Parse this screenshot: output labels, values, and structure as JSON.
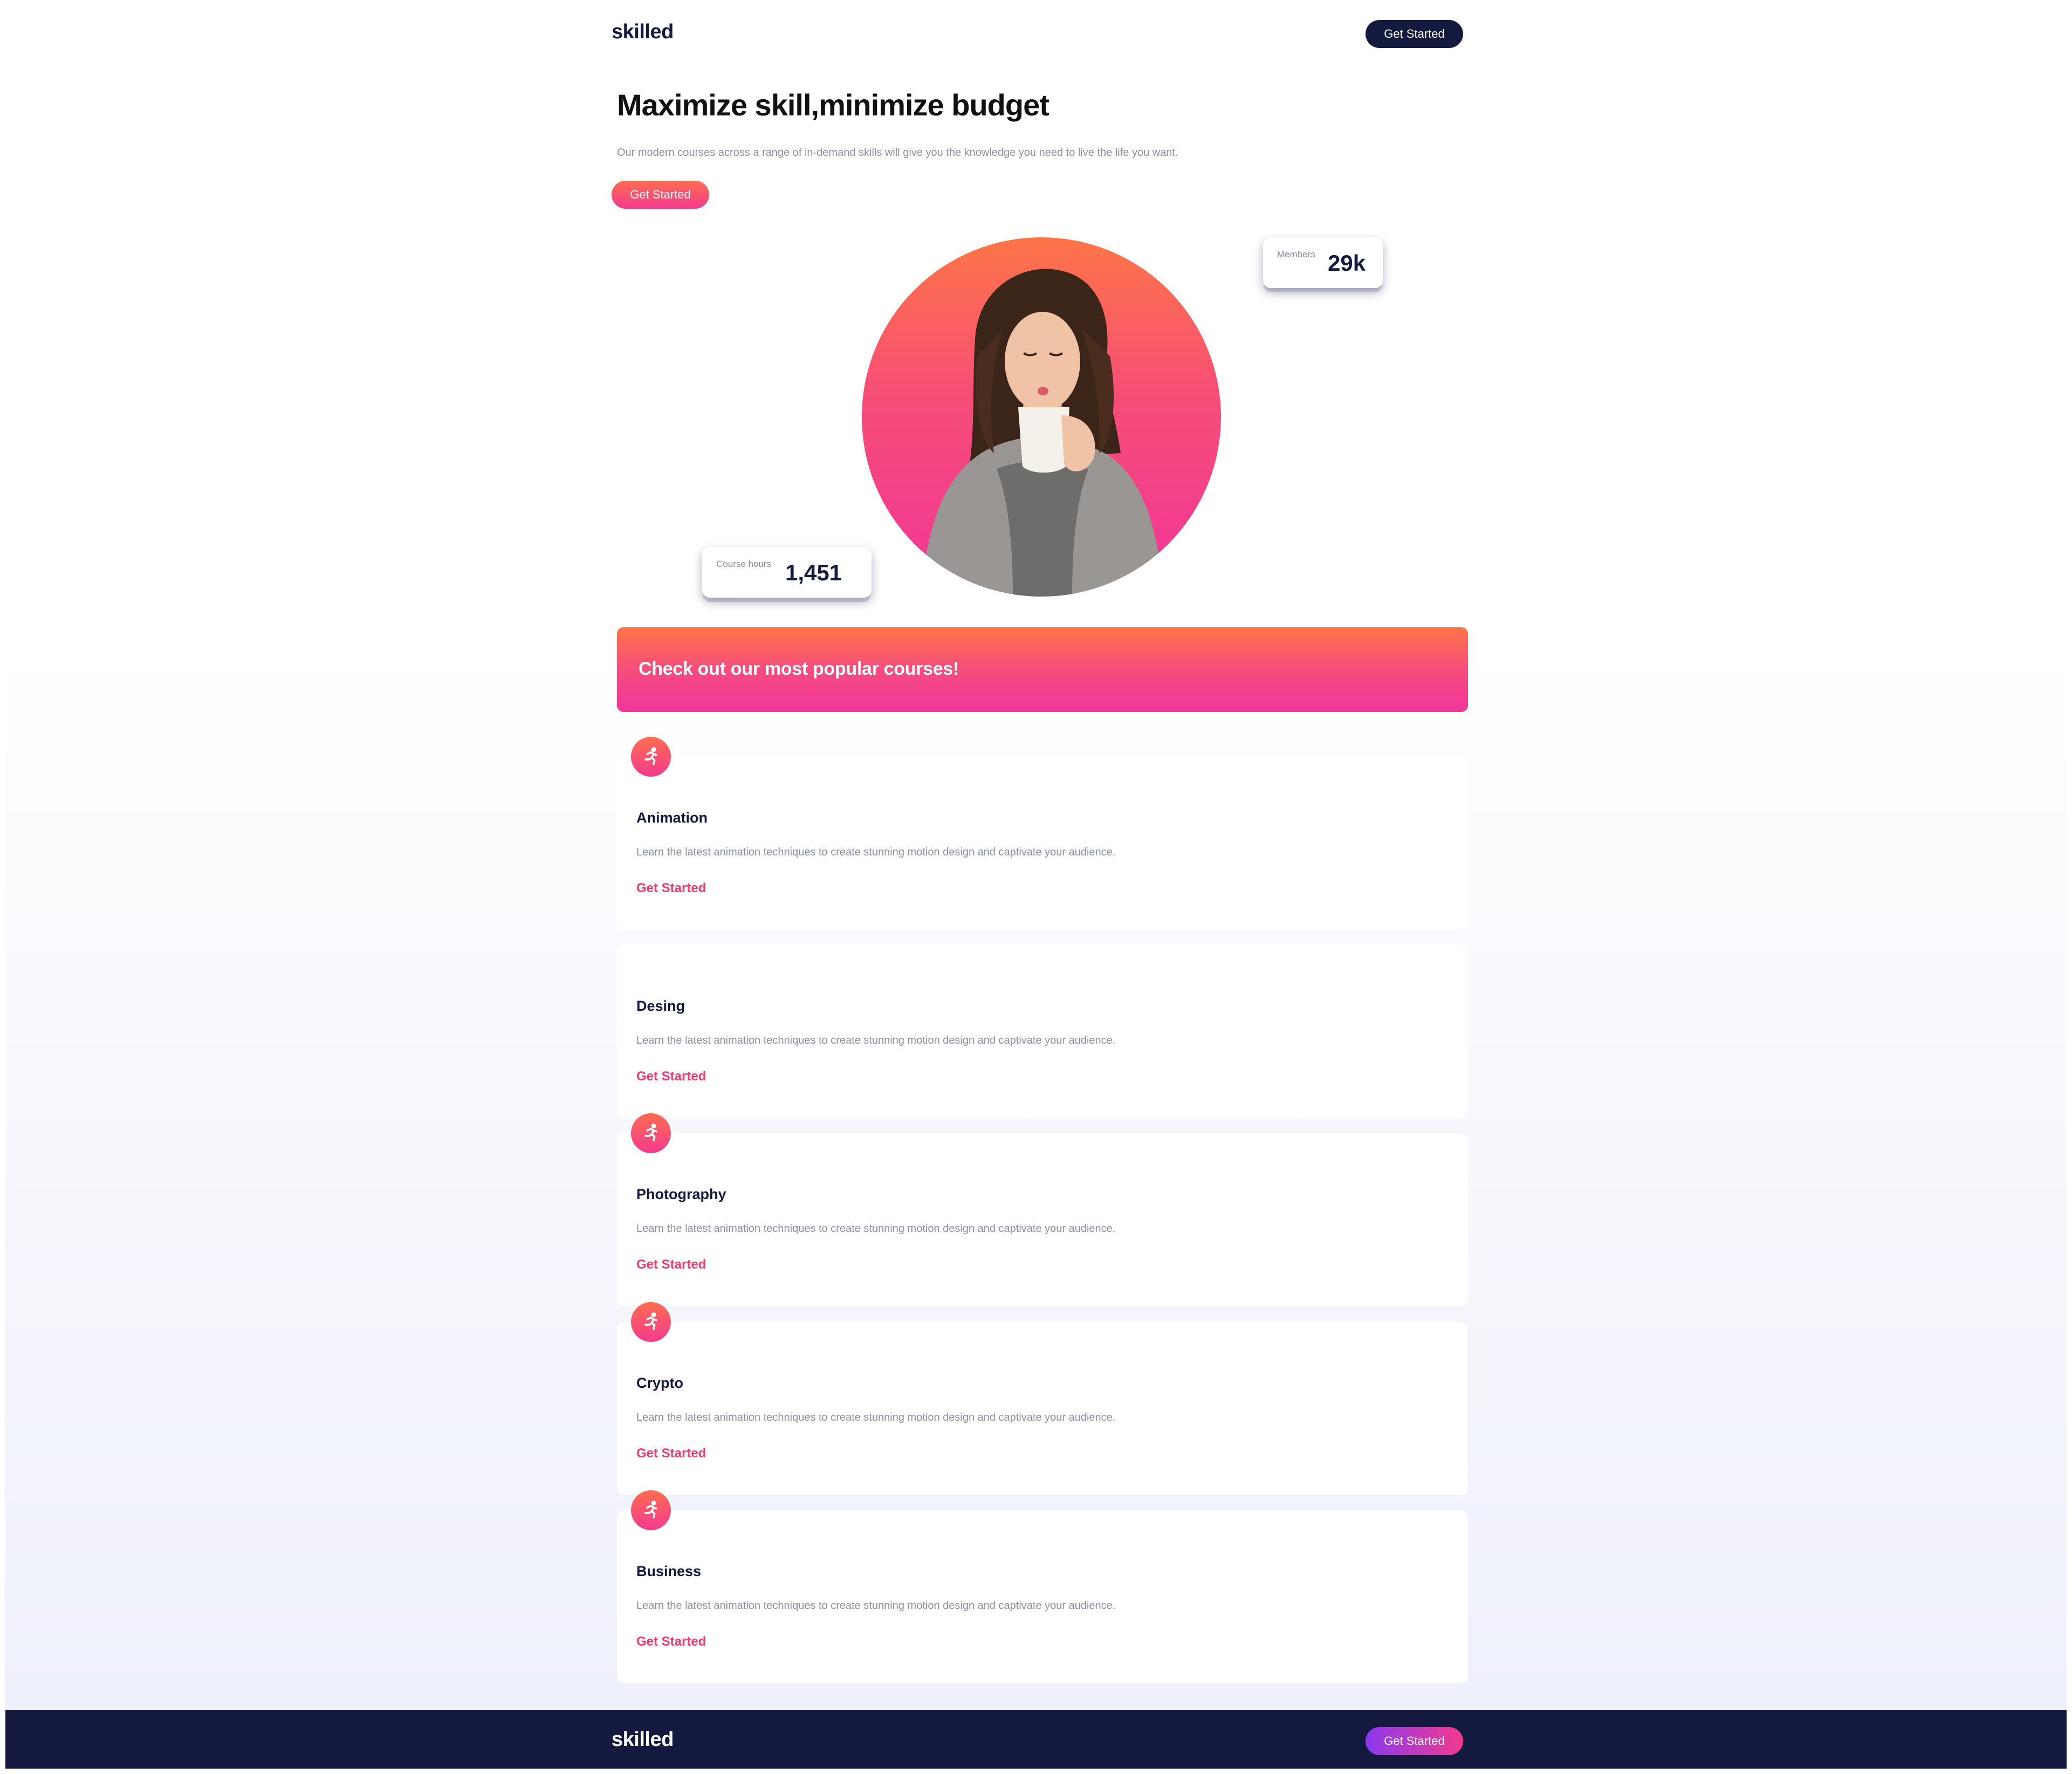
{
  "header": {
    "brand": "skilled",
    "cta_label": "Get Started"
  },
  "hero": {
    "title": "Maximize skill,minimize budget",
    "subtitle": "Our modern courses across a range of in-demand skills will give you the knowledge you need to live the life you want.",
    "cta_label": "Get Started",
    "image": "woman-drinking-coffee-photo",
    "stats": [
      {
        "label": "Members",
        "value": "29k"
      },
      {
        "label": "Course hours",
        "value": "1,451"
      }
    ]
  },
  "banner": {
    "title": "Check out our most popular courses!"
  },
  "courses": [
    {
      "title": "Animation",
      "description": "Learn the latest animation techniques to create stunning motion design and captivate your audience.",
      "link": "Get Started",
      "icon": "running-person-icon"
    },
    {
      "title": "Desing",
      "description": "Learn the latest animation techniques to create stunning motion design and captivate your audience.",
      "link": "Get Started",
      "icon": ""
    },
    {
      "title": "Photography",
      "description": "Learn the latest animation techniques to create stunning motion design and captivate your audience.",
      "link": "Get Started",
      "icon": "running-person-icon"
    },
    {
      "title": "Crypto",
      "description": "Learn the latest animation techniques to create stunning motion design and captivate your audience.",
      "link": "Get Started",
      "icon": "running-person-icon"
    },
    {
      "title": "Business",
      "description": "Learn the latest animation techniques to create stunning motion design and captivate your audience.",
      "link": "Get Started",
      "icon": "running-person-icon"
    }
  ],
  "footer": {
    "brand": "skilled",
    "cta_label": "Get Started"
  },
  "colors": {
    "navy": "#14193f",
    "pink": "#f33a8e",
    "orange": "#fe7547",
    "purple": "#8a39ef",
    "muted_text": "#8a8fa3"
  }
}
